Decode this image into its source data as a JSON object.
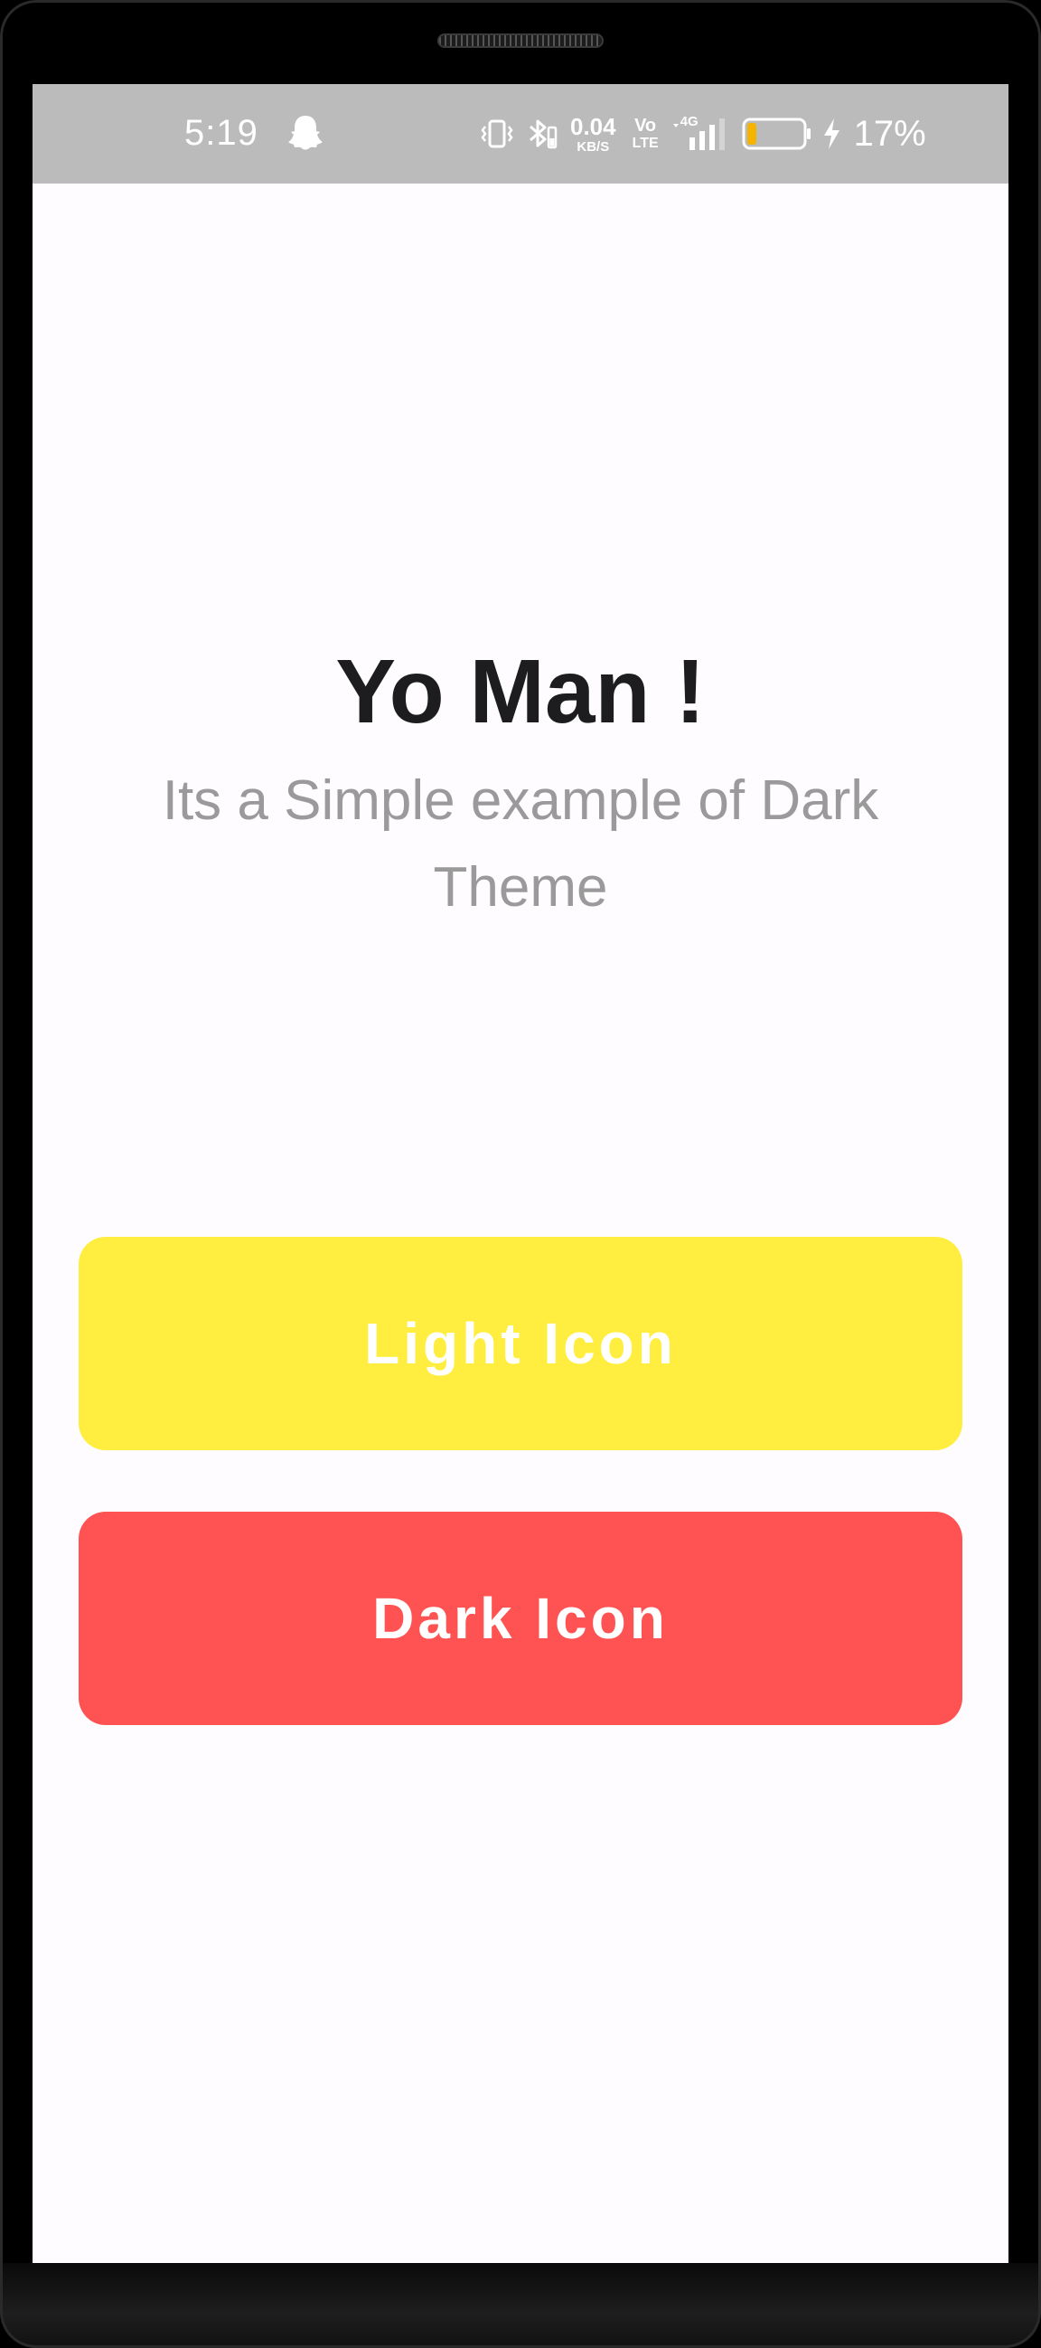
{
  "status_bar": {
    "time": "5:19",
    "net_speed_value": "0.04",
    "net_speed_unit": "KB/S",
    "volte_top": "Vo",
    "volte_bottom": "LTE",
    "network_type": "4G",
    "battery_percent": "17%",
    "battery_level": 0.17,
    "background_color": "#bcbbbb",
    "icons": [
      "snapchat-ghost-icon",
      "vibrate-icon",
      "bluetooth-icon",
      "volte-icon",
      "signal-icon",
      "battery-icon",
      "charging-bolt-icon"
    ]
  },
  "main": {
    "heading": "Yo Man !",
    "subtitle": "Its a Simple example of Dark Theme",
    "background_color": "#fffcff"
  },
  "buttons": {
    "light": {
      "label": "Light Icon",
      "color": "#ffee3f"
    },
    "dark": {
      "label": "Dark Icon",
      "color": "#ff5353"
    }
  }
}
